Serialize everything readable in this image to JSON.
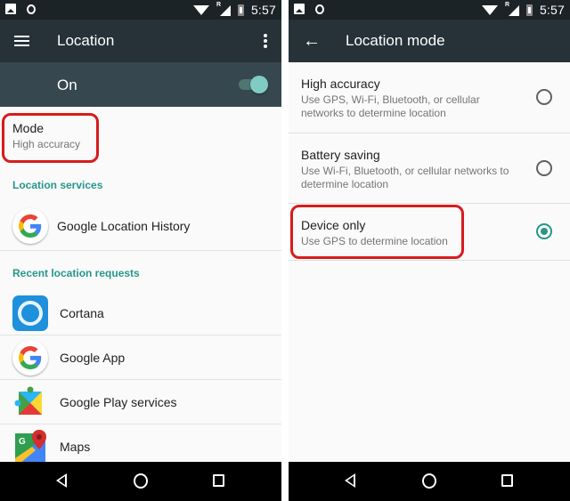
{
  "status_bar": {
    "time": "5:57",
    "icons": [
      "image-notification-icon",
      "shield-notification-icon",
      "wifi-icon",
      "cell-signal-roaming-icon",
      "battery-charging-icon"
    ],
    "roaming_indicator": "R"
  },
  "left_screen": {
    "app_bar": {
      "title": "Location",
      "nav_icon": "menu-icon",
      "action_icon": "overflow-menu-icon"
    },
    "master_switch": {
      "label": "On",
      "state": "on",
      "accent_color": "#80cbc4"
    },
    "mode": {
      "title": "Mode",
      "value": "High accuracy",
      "highlighted": true
    },
    "sections": [
      {
        "header": "Location services",
        "items": [
          {
            "label": "Google Location History",
            "icon": "google-g-icon"
          }
        ]
      },
      {
        "header": "Recent location requests",
        "items": [
          {
            "label": "Cortana",
            "icon": "cortana-icon"
          },
          {
            "label": "Google App",
            "icon": "google-g-icon"
          },
          {
            "label": "Google Play services",
            "icon": "google-play-services-icon"
          },
          {
            "label": "Maps",
            "icon": "google-maps-icon"
          }
        ]
      }
    ]
  },
  "right_screen": {
    "app_bar": {
      "title": "Location mode",
      "nav_icon": "back-arrow-icon"
    },
    "options": [
      {
        "title": "High accuracy",
        "subtitle": "Use GPS, Wi-Fi, Bluetooth, or cellular networks to determine location",
        "selected": false
      },
      {
        "title": "Battery saving",
        "subtitle": "Use Wi-Fi, Bluetooth, or cellular networks to determine location",
        "selected": false
      },
      {
        "title": "Device only",
        "subtitle": "Use GPS to determine location",
        "selected": true,
        "highlighted": true
      }
    ]
  },
  "nav_bar": {
    "buttons": [
      "back",
      "home",
      "recents"
    ]
  },
  "colors": {
    "app_bar": "#263238",
    "switch_bar": "#37474f",
    "accent": "#26978a",
    "highlight_outline": "#d81b1b"
  },
  "back_arrow_glyph": "←"
}
